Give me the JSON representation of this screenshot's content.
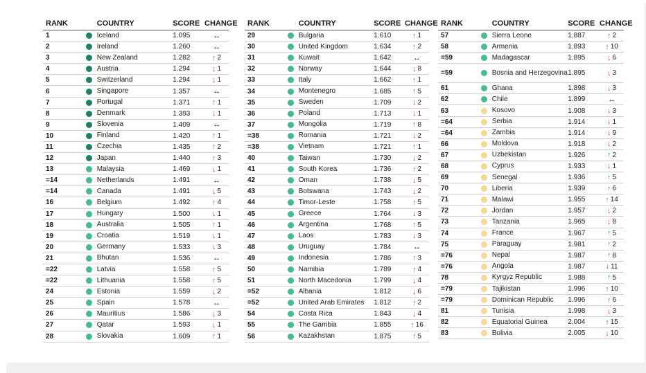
{
  "headers": {
    "rank": "RANK",
    "country": "COUNTRY",
    "score": "SCORE",
    "change": "CHANGE"
  },
  "colors": {
    "dark_green": "#1a7f6e",
    "mid_green": "#43b99a",
    "light_green": "#a6dfc9",
    "yellow": "#f5d98e",
    "up_arrow": "#2e9a6a",
    "down_arrow": "#d0342c"
  },
  "tables": [
    [
      {
        "rank": "1",
        "country": "Iceland",
        "score": "1.095",
        "change": "",
        "dir": "same",
        "color": "dark_green"
      },
      {
        "rank": "2",
        "country": "Ireland",
        "score": "1.260",
        "change": "",
        "dir": "same",
        "color": "dark_green"
      },
      {
        "rank": "3",
        "country": "New Zealand",
        "score": "1.282",
        "change": "2",
        "dir": "up",
        "color": "dark_green"
      },
      {
        "rank": "4",
        "country": "Austria",
        "score": "1.294",
        "change": "1",
        "dir": "down",
        "color": "dark_green"
      },
      {
        "rank": "5",
        "country": "Switzerland",
        "score": "1.294",
        "change": "1",
        "dir": "down",
        "color": "dark_green"
      },
      {
        "rank": "6",
        "country": "Singapore",
        "score": "1.357",
        "change": "",
        "dir": "same",
        "color": "dark_green"
      },
      {
        "rank": "7",
        "country": "Portugal",
        "score": "1.371",
        "change": "1",
        "dir": "up",
        "color": "dark_green"
      },
      {
        "rank": "8",
        "country": "Denmark",
        "score": "1.393",
        "change": "1",
        "dir": "down",
        "color": "dark_green"
      },
      {
        "rank": "9",
        "country": "Slovenia",
        "score": "1.409",
        "change": "",
        "dir": "same",
        "color": "dark_green"
      },
      {
        "rank": "10",
        "country": "Finland",
        "score": "1.420",
        "change": "1",
        "dir": "up",
        "color": "dark_green"
      },
      {
        "rank": "11",
        "country": "Czechia",
        "score": "1.435",
        "change": "2",
        "dir": "up",
        "color": "dark_green"
      },
      {
        "rank": "12",
        "country": "Japan",
        "score": "1.440",
        "change": "3",
        "dir": "up",
        "color": "dark_green"
      },
      {
        "rank": "13",
        "country": "Malaysia",
        "score": "1.469",
        "change": "1",
        "dir": "down",
        "color": "mid_green"
      },
      {
        "rank": "=14",
        "country": "Netherlands",
        "score": "1.491",
        "change": "",
        "dir": "same",
        "color": "mid_green"
      },
      {
        "rank": "=14",
        "country": "Canada",
        "score": "1.491",
        "change": "5",
        "dir": "down",
        "color": "mid_green"
      },
      {
        "rank": "16",
        "country": "Belgium",
        "score": "1.492",
        "change": "4",
        "dir": "up",
        "color": "mid_green"
      },
      {
        "rank": "17",
        "country": "Hungary",
        "score": "1.500",
        "change": "1",
        "dir": "down",
        "color": "mid_green"
      },
      {
        "rank": "18",
        "country": "Australia",
        "score": "1.505",
        "change": "1",
        "dir": "up",
        "color": "mid_green"
      },
      {
        "rank": "19",
        "country": "Croatia",
        "score": "1.519",
        "change": "1",
        "dir": "down",
        "color": "mid_green"
      },
      {
        "rank": "20",
        "country": "Germany",
        "score": "1.533",
        "change": "3",
        "dir": "down",
        "color": "mid_green"
      },
      {
        "rank": "21",
        "country": "Bhutan",
        "score": "1.536",
        "change": "",
        "dir": "same",
        "color": "mid_green"
      },
      {
        "rank": "=22",
        "country": "Latvia",
        "score": "1.558",
        "change": "5",
        "dir": "up",
        "color": "mid_green"
      },
      {
        "rank": "=22",
        "country": "Lithuania",
        "score": "1.558",
        "change": "5",
        "dir": "up",
        "color": "mid_green"
      },
      {
        "rank": "24",
        "country": "Estonia",
        "score": "1.559",
        "change": "2",
        "dir": "down",
        "color": "mid_green"
      },
      {
        "rank": "25",
        "country": "Spain",
        "score": "1.578",
        "change": "",
        "dir": "same",
        "color": "mid_green"
      },
      {
        "rank": "26",
        "country": "Mauritius",
        "score": "1.586",
        "change": "3",
        "dir": "down",
        "color": "mid_green"
      },
      {
        "rank": "27",
        "country": "Qatar",
        "score": "1.593",
        "change": "1",
        "dir": "down",
        "color": "mid_green"
      },
      {
        "rank": "28",
        "country": "Slovakia",
        "score": "1.609",
        "change": "1",
        "dir": "up",
        "color": "mid_green"
      }
    ],
    [
      {
        "rank": "29",
        "country": "Bulgaria",
        "score": "1.610",
        "change": "1",
        "dir": "up",
        "color": "mid_green"
      },
      {
        "rank": "30",
        "country": "United Kingdom",
        "score": "1.634",
        "change": "2",
        "dir": "up",
        "color": "mid_green"
      },
      {
        "rank": "31",
        "country": "Kuwait",
        "score": "1.642",
        "change": "",
        "dir": "same",
        "color": "mid_green"
      },
      {
        "rank": "32",
        "country": "Norway",
        "score": "1.644",
        "change": "8",
        "dir": "down",
        "color": "mid_green"
      },
      {
        "rank": "33",
        "country": "Italy",
        "score": "1.662",
        "change": "1",
        "dir": "up",
        "color": "mid_green"
      },
      {
        "rank": "34",
        "country": "Montenegro",
        "score": "1.685",
        "change": "5",
        "dir": "up",
        "color": "mid_green"
      },
      {
        "rank": "35",
        "country": "Sweden",
        "score": "1.709",
        "change": "2",
        "dir": "down",
        "color": "mid_green"
      },
      {
        "rank": "36",
        "country": "Poland",
        "score": "1.713",
        "change": "1",
        "dir": "down",
        "color": "mid_green"
      },
      {
        "rank": "37",
        "country": "Mongolia",
        "score": "1.719",
        "change": "8",
        "dir": "up",
        "color": "mid_green"
      },
      {
        "rank": "=38",
        "country": "Romania",
        "score": "1.721",
        "change": "2",
        "dir": "down",
        "color": "mid_green"
      },
      {
        "rank": "=38",
        "country": "Vietnam",
        "score": "1.721",
        "change": "1",
        "dir": "up",
        "color": "mid_green"
      },
      {
        "rank": "40",
        "country": "Taiwan",
        "score": "1.730",
        "change": "2",
        "dir": "down",
        "color": "mid_green"
      },
      {
        "rank": "41",
        "country": "South Korea",
        "score": "1.736",
        "change": "2",
        "dir": "up",
        "color": "mid_green"
      },
      {
        "rank": "42",
        "country": "Oman",
        "score": "1.738",
        "change": "5",
        "dir": "down",
        "color": "mid_green"
      },
      {
        "rank": "43",
        "country": "Botswana",
        "score": "1.743",
        "change": "2",
        "dir": "down",
        "color": "mid_green"
      },
      {
        "rank": "44",
        "country": "Timor-Leste",
        "score": "1.758",
        "change": "5",
        "dir": "up",
        "color": "mid_green"
      },
      {
        "rank": "45",
        "country": "Greece",
        "score": "1.764",
        "change": "3",
        "dir": "down",
        "color": "mid_green"
      },
      {
        "rank": "46",
        "country": "Argentina",
        "score": "1.768",
        "change": "5",
        "dir": "up",
        "color": "mid_green"
      },
      {
        "rank": "47",
        "country": "Laos",
        "score": "1.783",
        "change": "3",
        "dir": "down",
        "color": "mid_green"
      },
      {
        "rank": "48",
        "country": "Uruguay",
        "score": "1.784",
        "change": "",
        "dir": "same",
        "color": "mid_green"
      },
      {
        "rank": "49",
        "country": "Indonesia",
        "score": "1.786",
        "change": "3",
        "dir": "up",
        "color": "mid_green"
      },
      {
        "rank": "50",
        "country": "Namibia",
        "score": "1.789",
        "change": "4",
        "dir": "up",
        "color": "mid_green"
      },
      {
        "rank": "51",
        "country": "North Macedonia",
        "score": "1.799",
        "change": "4",
        "dir": "down",
        "color": "mid_green"
      },
      {
        "rank": "=52",
        "country": "Albania",
        "score": "1.812",
        "change": "6",
        "dir": "down",
        "color": "mid_green"
      },
      {
        "rank": "=52",
        "country": "United Arab Emirates",
        "score": "1.812",
        "change": "2",
        "dir": "up",
        "color": "mid_green"
      },
      {
        "rank": "54",
        "country": "Costa Rica",
        "score": "1.843",
        "change": "4",
        "dir": "down",
        "color": "mid_green"
      },
      {
        "rank": "55",
        "country": "The Gambia",
        "score": "1.855",
        "change": "16",
        "dir": "up",
        "color": "mid_green"
      },
      {
        "rank": "56",
        "country": "Kazakhstan",
        "score": "1.875",
        "change": "5",
        "dir": "up",
        "color": "mid_green"
      }
    ],
    [
      {
        "rank": "57",
        "country": "Sierra Leone",
        "score": "1.887",
        "change": "2",
        "dir": "up",
        "color": "mid_green"
      },
      {
        "rank": "58",
        "country": "Armenia",
        "score": "1.893",
        "change": "10",
        "dir": "up",
        "color": "mid_green"
      },
      {
        "rank": "=59",
        "country": "Madagascar",
        "score": "1.895",
        "change": "6",
        "dir": "down",
        "color": "mid_green"
      },
      {
        "rank": "=59",
        "country": "Bosnia and Herzegovina",
        "score": "1.895",
        "change": "3",
        "dir": "down",
        "color": "mid_green",
        "tall": true
      },
      {
        "rank": "61",
        "country": "Ghana",
        "score": "1.898",
        "change": "3",
        "dir": "down",
        "color": "mid_green"
      },
      {
        "rank": "62",
        "country": "Chile",
        "score": "1.899",
        "change": "",
        "dir": "same",
        "color": "mid_green"
      },
      {
        "rank": "63",
        "country": "Kosovo",
        "score": "1.908",
        "change": "3",
        "dir": "down",
        "color": "yellow"
      },
      {
        "rank": "=64",
        "country": "Serbia",
        "score": "1.914",
        "change": "1",
        "dir": "down",
        "color": "yellow"
      },
      {
        "rank": "=64",
        "country": "Zambia",
        "score": "1.914",
        "change": "9",
        "dir": "down",
        "color": "yellow"
      },
      {
        "rank": "66",
        "country": "Moldova",
        "score": "1.918",
        "change": "2",
        "dir": "down",
        "color": "yellow"
      },
      {
        "rank": "67",
        "country": "Uzbekistan",
        "score": "1.926",
        "change": "2",
        "dir": "up",
        "color": "yellow"
      },
      {
        "rank": "68",
        "country": "Cyprus",
        "score": "1.933",
        "change": "1",
        "dir": "down",
        "color": "yellow"
      },
      {
        "rank": "69",
        "country": "Senegal",
        "score": "1.936",
        "change": "5",
        "dir": "up",
        "color": "yellow"
      },
      {
        "rank": "70",
        "country": "Liberia",
        "score": "1.939",
        "change": "6",
        "dir": "up",
        "color": "yellow"
      },
      {
        "rank": "71",
        "country": "Malawi",
        "score": "1.955",
        "change": "14",
        "dir": "up",
        "color": "yellow"
      },
      {
        "rank": "72",
        "country": "Jordan",
        "score": "1.957",
        "change": "2",
        "dir": "down",
        "color": "yellow"
      },
      {
        "rank": "73",
        "country": "Tanzania",
        "score": "1.965",
        "change": "8",
        "dir": "down",
        "color": "yellow"
      },
      {
        "rank": "74",
        "country": "France",
        "score": "1.967",
        "change": "5",
        "dir": "up",
        "color": "yellow"
      },
      {
        "rank": "75",
        "country": "Paraguay",
        "score": "1.981",
        "change": "2",
        "dir": "up",
        "color": "yellow"
      },
      {
        "rank": "=76",
        "country": "Nepal",
        "score": "1.987",
        "change": "8",
        "dir": "up",
        "color": "yellow"
      },
      {
        "rank": "=76",
        "country": "Angola",
        "score": "1.987",
        "change": "11",
        "dir": "down",
        "color": "yellow"
      },
      {
        "rank": "78",
        "country": "Kyrgyz Republic",
        "score": "1.988",
        "change": "5",
        "dir": "up",
        "color": "yellow"
      },
      {
        "rank": "=79",
        "country": "Tajikistan",
        "score": "1.996",
        "change": "10",
        "dir": "up",
        "color": "yellow"
      },
      {
        "rank": "=79",
        "country": "Dominican Republic",
        "score": "1.996",
        "change": "6",
        "dir": "up",
        "color": "yellow"
      },
      {
        "rank": "81",
        "country": "Tunisia",
        "score": "1.998",
        "change": "3",
        "dir": "down",
        "color": "yellow"
      },
      {
        "rank": "82",
        "country": "Equatorial Guinea",
        "score": "2.004",
        "change": "15",
        "dir": "up",
        "color": "yellow"
      },
      {
        "rank": "83",
        "country": "Bolivia",
        "score": "2.005",
        "change": "10",
        "dir": "down",
        "color": "yellow"
      }
    ]
  ]
}
